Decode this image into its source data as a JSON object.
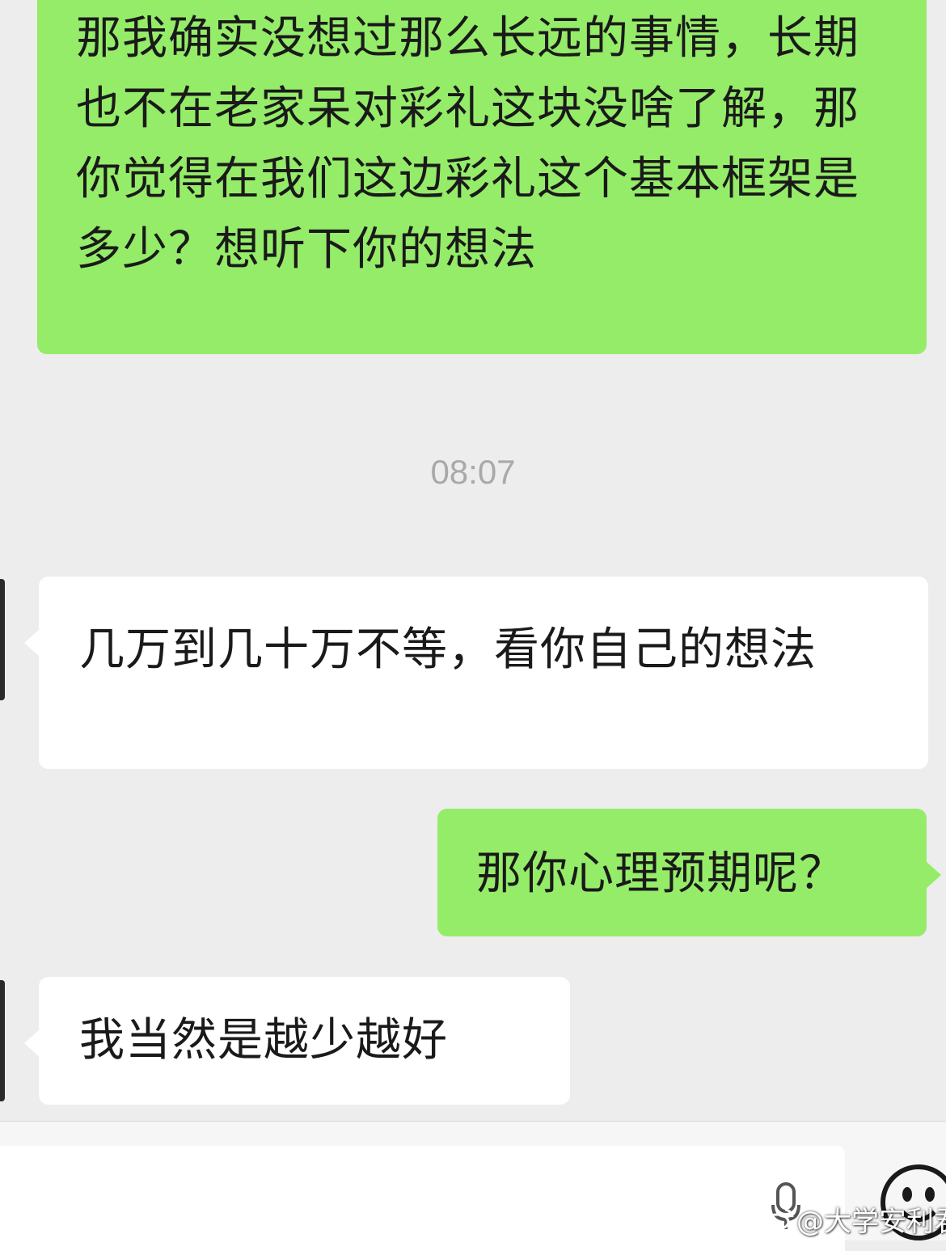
{
  "messages": [
    {
      "side": "outgoing",
      "text": "那我确实没想过那么长远的事情，长期也不在老家呆对彩礼这块没啥了解，那你觉得在我们这边彩礼这个基本框架是多少？想听下你的想法"
    },
    {
      "side": "incoming",
      "text": "几万到几十万不等，看你自己的想法"
    },
    {
      "side": "outgoing",
      "text": "那你心理预期呢？"
    },
    {
      "side": "incoming",
      "text": "我当然是越少越好"
    }
  ],
  "timestamp": "08:07",
  "watermark": {
    "text": "@大学安利君"
  },
  "colors": {
    "background": "#ededed",
    "outgoing_bubble": "#95ec69",
    "incoming_bubble": "#ffffff",
    "timestamp": "#a9a9a9"
  },
  "icons": {
    "input_voice": "microphone-icon",
    "input_emoji": "emoji-icon",
    "watermark_logo": "weibo-logo"
  }
}
